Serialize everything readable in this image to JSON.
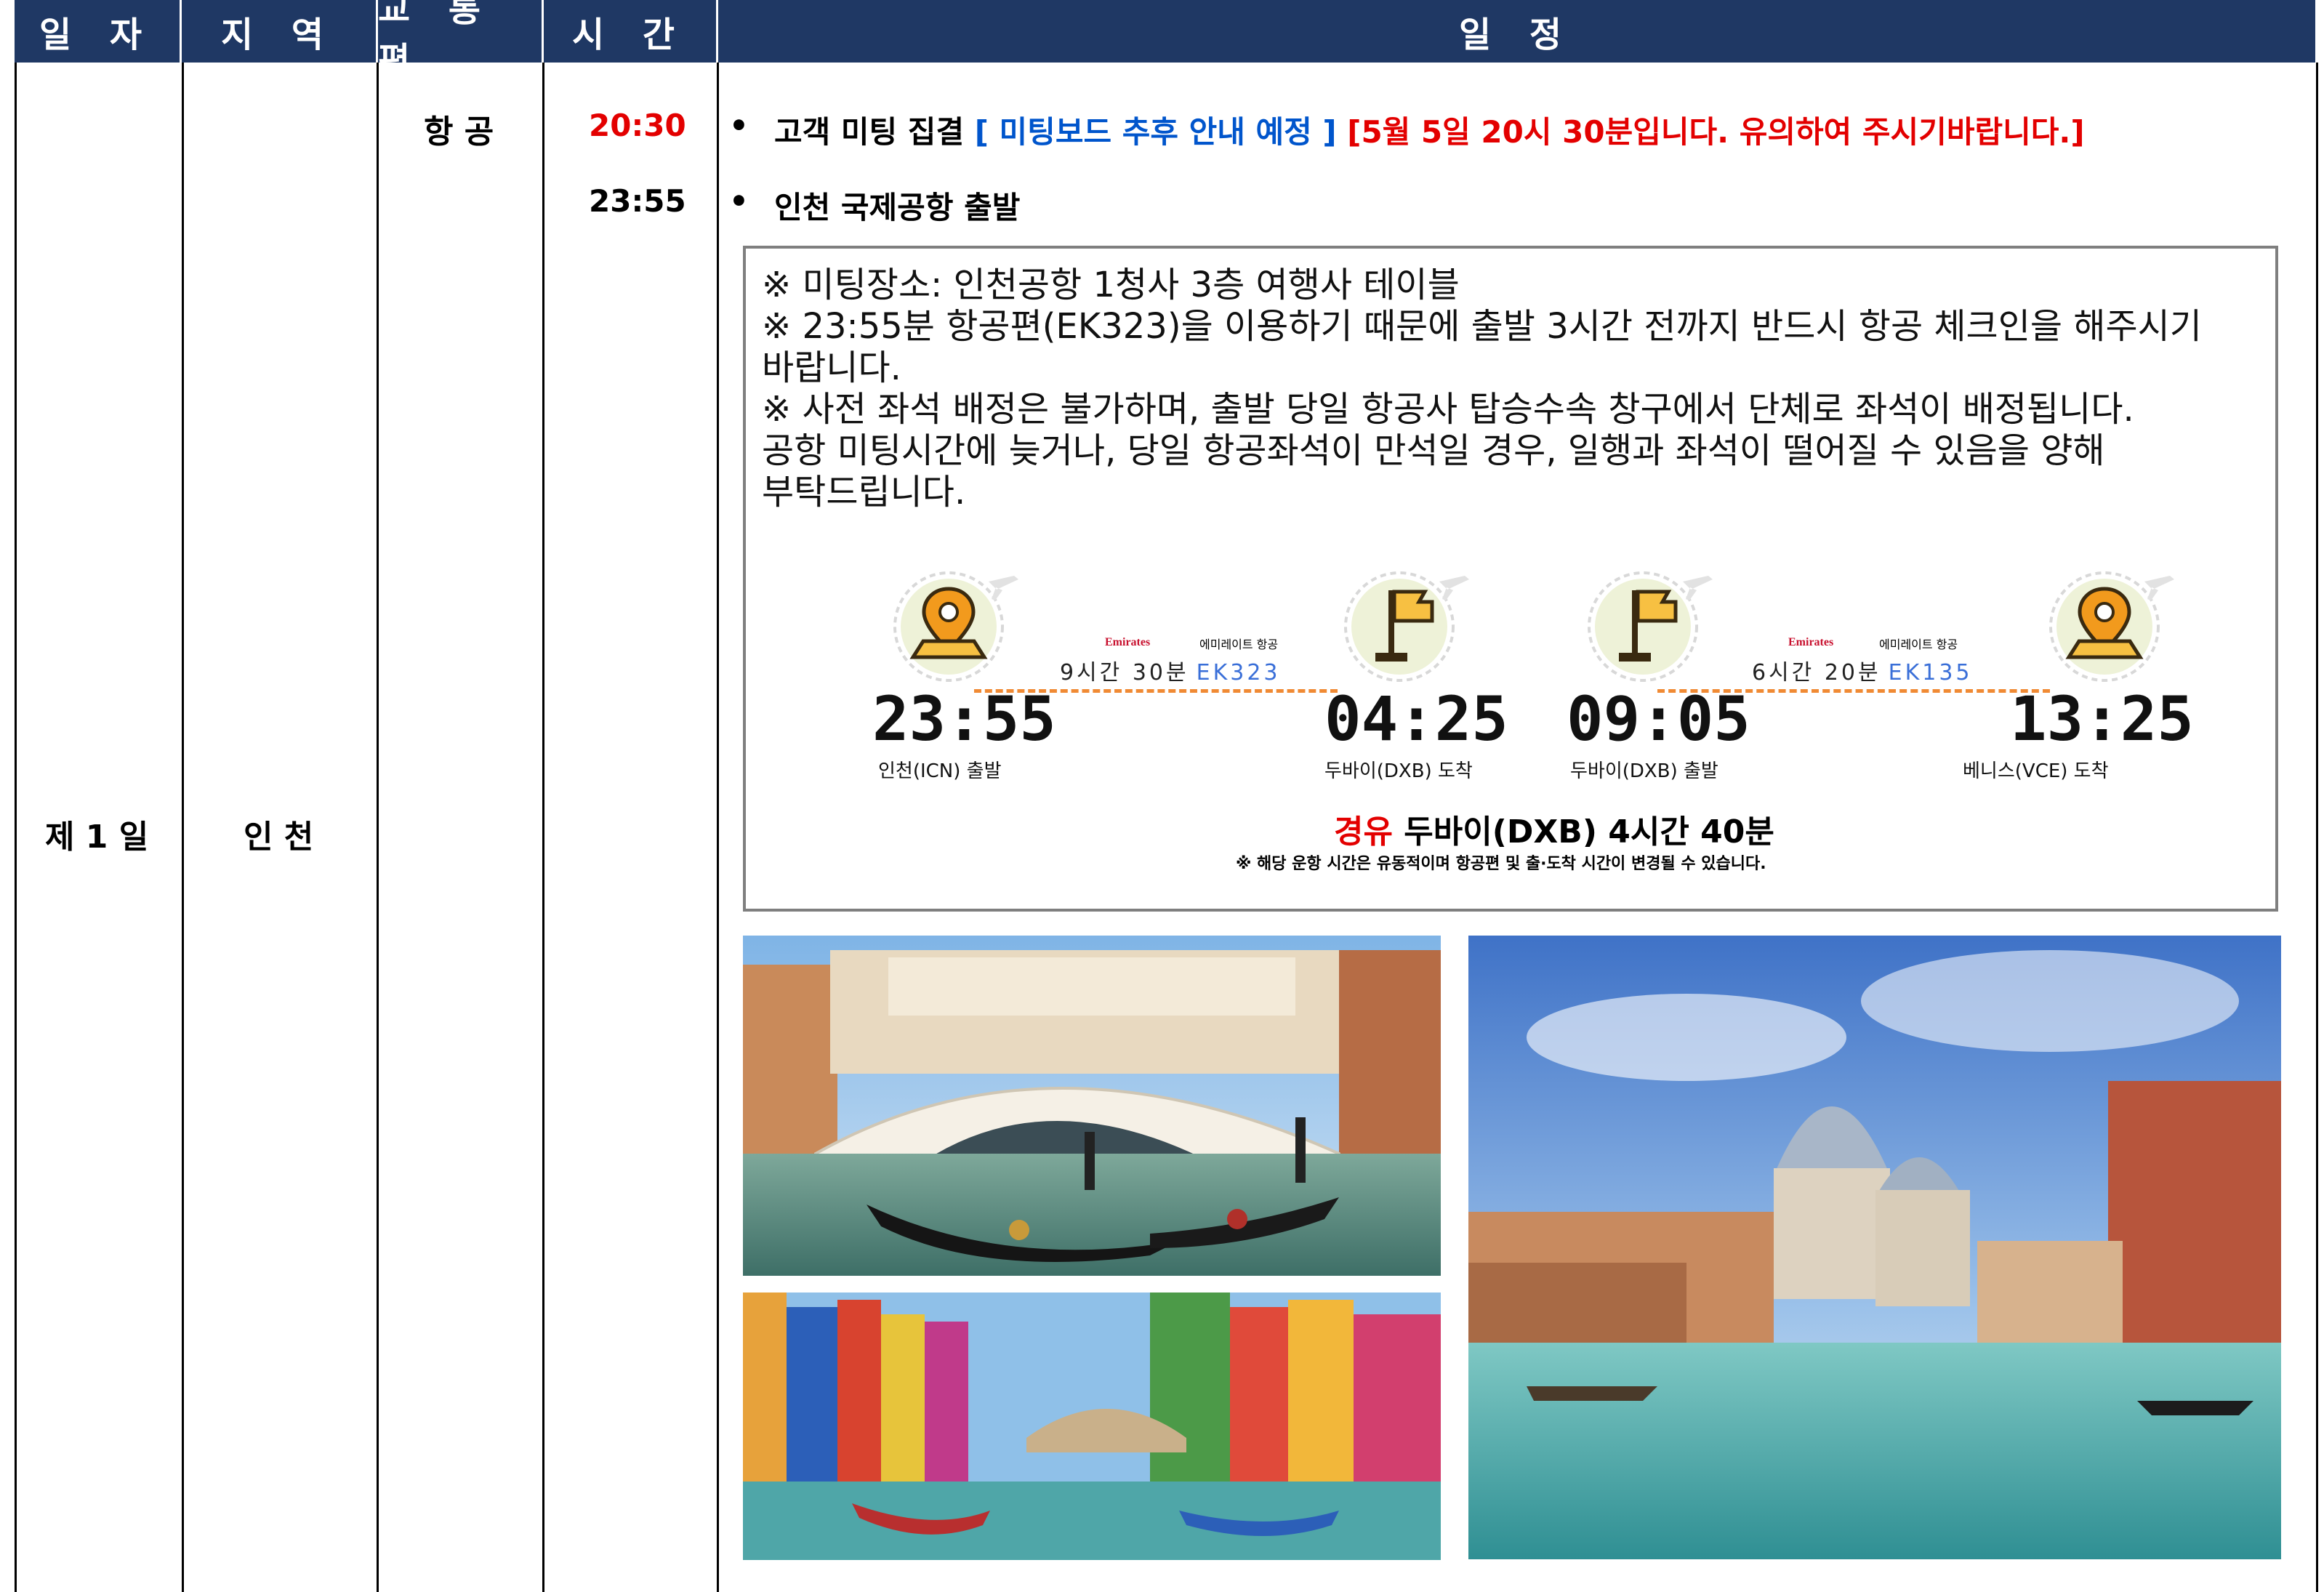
{
  "header": {
    "col_day": "일 자",
    "col_region": "지 역",
    "col_transport": "교 통 편",
    "col_time": "시 간",
    "col_schedule": "일 정"
  },
  "row": {
    "day": "제 1 일",
    "region": "인 천",
    "transport": "항 공"
  },
  "schedule": [
    {
      "time": "20:30",
      "time_color": "#e30000",
      "bullet": "•",
      "text": "고객 미팅 집결",
      "note_blue": "[ 미팅보드 추후 안내 예정 ]",
      "note_red": "[5월 5일 20시 30분입니다. 유의하여 주시기바랍니다.]"
    },
    {
      "time": "23:55",
      "bullet": "•",
      "text": "인천 국제공항 출발"
    }
  ],
  "notice": {
    "lines": [
      "※ 미팅장소: 인천공항 1청사 3층 여행사 테이블",
      "※ 23:55분 항공편(EK323)을 이용하기 때문에 출발 3시간 전까지 반드시 항공 체크인을 해주시기",
      "바랍니다.",
      "※ 사전 좌석 배정은 불가하며, 출발 당일 항공사 탑승수속 창구에서 단체로 좌석이 배정됩니다.",
      "공항 미팅시간에 늦거나, 당일 항공좌석이 만석일 경우, 일행과 좌석이 떨어질 수 있음을 양해",
      "부탁드립니다."
    ]
  },
  "flights": {
    "leg1": {
      "airline_logo": "Emirates",
      "airline_name": "에미레이트 항공",
      "duration": "9시간 30분",
      "flight_no": "EK323",
      "dep_time": "23:55",
      "dep_label": "인천(ICN) 출발",
      "arr_time": "04:25",
      "arr_label": "두바이(DXB) 도착"
    },
    "leg2": {
      "airline_logo": "Emirates",
      "airline_name": "에미레이트 항공",
      "duration": "6시간 20분",
      "flight_no": "EK135",
      "dep_time": "09:05",
      "dep_label": "두바이(DXB) 출발",
      "arr_time": "13:25",
      "arr_label": "베니스(VCE) 도착"
    },
    "layover_word": "경유",
    "layover_text": "두바이(DXB) 4시간 40분",
    "disclaimer": "※ 해당 운항 시간은 유동적이며 항공편 및 출·도착 시간이 변경될 수 있습니다."
  },
  "icons": {
    "origin_pin": "location-pin-icon",
    "flag": "flag-icon",
    "plane": "airplane-icon"
  },
  "colors": {
    "header_bg": "#1f3864",
    "accent_red": "#e30000",
    "accent_blue": "#0055cc",
    "route_dash": "#f08a34",
    "icon_orange": "#f0a020"
  },
  "photos": [
    "rialto-bridge-photo",
    "burano-canal-photo",
    "grand-canal-photo"
  ]
}
